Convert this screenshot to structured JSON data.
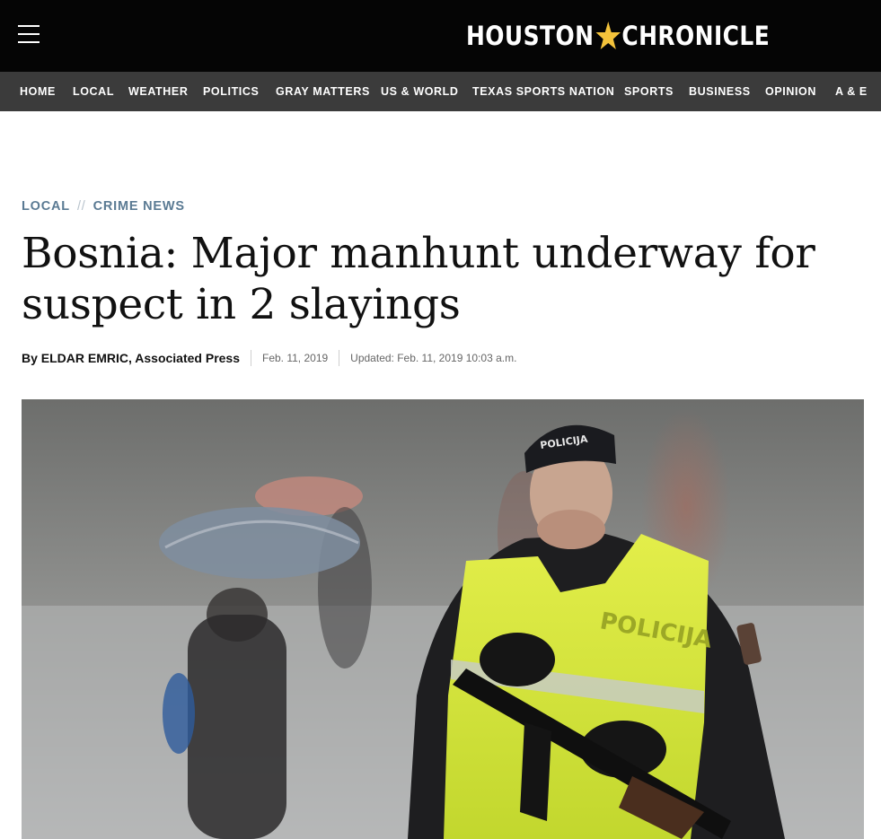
{
  "header": {
    "menu_icon": "hamburger-menu-icon",
    "logo_left": "HOUSTON",
    "logo_right": "CHRONICLE",
    "logo_star_color": "#f4c33b"
  },
  "nav": {
    "items": [
      {
        "label": "HOME"
      },
      {
        "label": "LOCAL"
      },
      {
        "label": "WEATHER"
      },
      {
        "label": "POLITICS"
      },
      {
        "label": "GRAY MATTERS"
      },
      {
        "label": "US & WORLD"
      },
      {
        "label": "TEXAS SPORTS NATION"
      },
      {
        "label": "SPORTS"
      },
      {
        "label": "BUSINESS"
      },
      {
        "label": "OPINION"
      },
      {
        "label": "A & E"
      }
    ]
  },
  "article": {
    "section": "LOCAL",
    "separator": "//",
    "subsection": "CRIME NEWS",
    "headline": "Bosnia: Major manhunt underway for suspect in 2 slayings",
    "byline": "By ELDAR EMRIC, Associated Press",
    "published": "Feb. 11, 2019",
    "updated": "Updated: Feb. 11, 2019 10:03 a.m.",
    "photo": {
      "cap_text": "POLICIJA",
      "vest_text": "POLICIJA"
    }
  },
  "colors": {
    "topbar": "#050505",
    "navbar": "#3b3b3b",
    "kicker": "#5a7a93",
    "vest": "#d6e83a"
  }
}
